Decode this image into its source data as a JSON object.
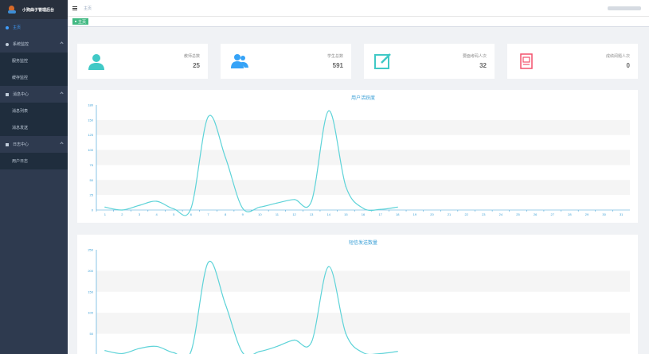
{
  "sidebar": {
    "logo_text": "小狗曲子管理后台",
    "items": [
      {
        "label": "主页"
      },
      {
        "label": "系统监控",
        "children": [
          {
            "label": "服务监控"
          },
          {
            "label": "缓存监控"
          }
        ]
      },
      {
        "label": "消息中心",
        "children": [
          {
            "label": "消息列表"
          },
          {
            "label": "消息发送"
          }
        ]
      },
      {
        "label": "日志中心",
        "children": [
          {
            "label": "用户日志"
          }
        ]
      }
    ]
  },
  "header": {
    "breadcrumb": "主页"
  },
  "tags": {
    "active": "主页"
  },
  "colors": {
    "sidebar_bg": "#2e3a4f",
    "accent": "#3a9fd6",
    "line": "#5ed3d8",
    "tag": "#42b983"
  },
  "cards": [
    {
      "label": "教师总数",
      "value": "25",
      "icon": "teacher-icon"
    },
    {
      "label": "学生总数",
      "value": "591",
      "icon": "students-icon"
    },
    {
      "label": "要面考码人次",
      "value": "32",
      "icon": "edit-icon"
    },
    {
      "label": "成绩阅题人次",
      "value": "0",
      "icon": "certificate-icon"
    }
  ],
  "chart_data": [
    {
      "type": "line",
      "title": "用户活跃度",
      "x": [
        "1",
        "2",
        "3",
        "4",
        "5",
        "6",
        "7",
        "8",
        "9",
        "10",
        "11",
        "12",
        "13",
        "14",
        "15",
        "16",
        "17",
        "18",
        "19",
        "20",
        "21",
        "22",
        "23",
        "24",
        "25",
        "26",
        "27",
        "28",
        "29",
        "30",
        "31"
      ],
      "values": [
        5,
        0,
        8,
        15,
        2,
        3,
        160,
        90,
        3,
        5,
        12,
        18,
        15,
        170,
        40,
        3,
        1,
        5
      ],
      "yticks": [
        "0",
        "25",
        "50",
        "75",
        "100",
        "125",
        "150",
        "180"
      ],
      "ylim": [
        0,
        180
      ]
    },
    {
      "type": "line",
      "title": "短信发送数量",
      "x": [
        "1",
        "2",
        "3",
        "4",
        "5",
        "6",
        "7",
        "8",
        "9",
        "10",
        "11",
        "12",
        "13",
        "14",
        "15",
        "16",
        "17",
        "18",
        "19",
        "20",
        "21",
        "22",
        "23",
        "24",
        "25",
        "26",
        "27",
        "28",
        "29",
        "30",
        "31"
      ],
      "values": [
        10,
        3,
        15,
        20,
        5,
        8,
        220,
        120,
        5,
        8,
        20,
        35,
        30,
        210,
        50,
        5,
        3,
        8
      ],
      "yticks": [
        "0",
        "50",
        "100",
        "150",
        "200",
        "250"
      ],
      "ylim": [
        0,
        250
      ]
    }
  ]
}
